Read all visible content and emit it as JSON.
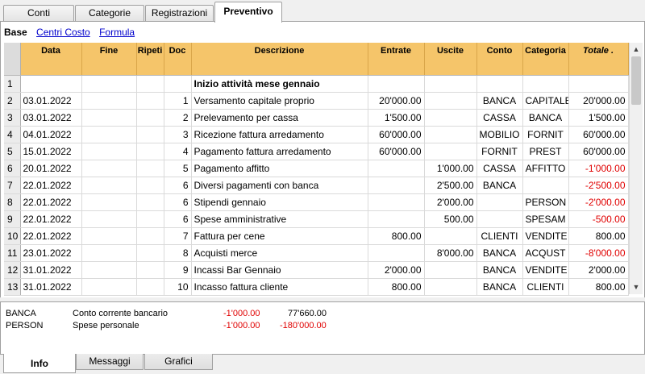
{
  "top_tabs": [
    "Conti",
    "Categorie",
    "Registrazioni",
    "Preventivo"
  ],
  "views": {
    "active": "Base",
    "links": [
      "Centri Costo",
      "Formula"
    ]
  },
  "columns": [
    "Data",
    "Fine",
    "Ripeti",
    "Doc",
    "Descrizione",
    "Entrate",
    "Uscite",
    "Conto",
    "Categoria",
    "Totale ."
  ],
  "rows": [
    {
      "n": "1",
      "data": "",
      "fine": "",
      "ripeti": "",
      "doc": "",
      "descr": "Inizio attività mese gennaio",
      "entrate": "",
      "uscite": "",
      "conto": "",
      "cat": "",
      "totale": "",
      "bold": true
    },
    {
      "n": "2",
      "data": "03.01.2022",
      "fine": "",
      "ripeti": "",
      "doc": "1",
      "descr": "Versamento capitale proprio",
      "entrate": "20'000.00",
      "uscite": "",
      "conto": "BANCA",
      "cat": "CAPITALE",
      "totale": "20'000.00"
    },
    {
      "n": "3",
      "data": "03.01.2022",
      "fine": "",
      "ripeti": "",
      "doc": "2",
      "descr": "Prelevamento per cassa",
      "entrate": "1'500.00",
      "uscite": "",
      "conto": "CASSA",
      "cat": "BANCA",
      "totale": "1'500.00"
    },
    {
      "n": "4",
      "data": "04.01.2022",
      "fine": "",
      "ripeti": "",
      "doc": "3",
      "descr": "Ricezione fattura arredamento",
      "entrate": "60'000.00",
      "uscite": "",
      "conto": "MOBILIO",
      "cat": "FORNIT",
      "totale": "60'000.00"
    },
    {
      "n": "5",
      "data": "15.01.2022",
      "fine": "",
      "ripeti": "",
      "doc": "4",
      "descr": "Pagamento fattura arredamento",
      "entrate": "60'000.00",
      "uscite": "",
      "conto": "FORNIT",
      "cat": "PREST",
      "totale": "60'000.00"
    },
    {
      "n": "6",
      "data": "20.01.2022",
      "fine": "",
      "ripeti": "",
      "doc": "5",
      "descr": "Pagamento affitto",
      "entrate": "",
      "uscite": "1'000.00",
      "conto": "CASSA",
      "cat": "AFFITTO",
      "totale": "-1'000.00",
      "neg": true
    },
    {
      "n": "7",
      "data": "22.01.2022",
      "fine": "",
      "ripeti": "",
      "doc": "6",
      "descr": "Diversi pagamenti con banca",
      "entrate": "",
      "uscite": "2'500.00",
      "conto": "BANCA",
      "cat": "",
      "totale": "-2'500.00",
      "neg": true
    },
    {
      "n": "8",
      "data": "22.01.2022",
      "fine": "",
      "ripeti": "",
      "doc": "6",
      "descr": "Stipendi gennaio",
      "entrate": "",
      "uscite": "2'000.00",
      "conto": "",
      "cat": "PERSON",
      "totale": "-2'000.00",
      "neg": true
    },
    {
      "n": "9",
      "data": "22.01.2022",
      "fine": "",
      "ripeti": "",
      "doc": "6",
      "descr": "Spese amministrative",
      "entrate": "",
      "uscite": "500.00",
      "conto": "",
      "cat": "SPESAM",
      "totale": "-500.00",
      "neg": true
    },
    {
      "n": "10",
      "data": "22.01.2022",
      "fine": "",
      "ripeti": "",
      "doc": "7",
      "descr": "Fattura per cene",
      "entrate": "800.00",
      "uscite": "",
      "conto": "CLIENTI",
      "cat": "VENDITE",
      "totale": "800.00"
    },
    {
      "n": "11",
      "data": "23.01.2022",
      "fine": "",
      "ripeti": "",
      "doc": "8",
      "descr": "Acquisti merce",
      "entrate": "",
      "uscite": "8'000.00",
      "conto": "BANCA",
      "cat": "ACQUST",
      "totale": "-8'000.00",
      "neg": true
    },
    {
      "n": "12",
      "data": "31.01.2022",
      "fine": "",
      "ripeti": "",
      "doc": "9",
      "descr": "Incassi Bar Gennaio",
      "entrate": "2'000.00",
      "uscite": "",
      "conto": "BANCA",
      "cat": "VENDITE",
      "totale": "2'000.00"
    },
    {
      "n": "13",
      "data": "31.01.2022",
      "fine": "",
      "ripeti": "",
      "doc": "10",
      "descr": "Incasso fattura cliente",
      "entrate": "800.00",
      "uscite": "",
      "conto": "BANCA",
      "cat": "CLIENTI",
      "totale": "800.00"
    }
  ],
  "info": [
    {
      "code": "BANCA",
      "desc": "Conto corrente bancario",
      "amount": "-1'000.00",
      "balance": "77'660.00",
      "balance_neg": false
    },
    {
      "code": "PERSON",
      "desc": "Spese personale",
      "amount": "-1'000.00",
      "balance": "-180'000.00",
      "balance_neg": true
    }
  ],
  "bottom_tabs": [
    "Info",
    "Messaggi",
    "Grafici"
  ],
  "colors": {
    "header": "#f5c56a",
    "negative": "#e00000",
    "link": "#0000cc"
  },
  "icons": {
    "scroll_up": "▲",
    "scroll_down": "▼"
  }
}
